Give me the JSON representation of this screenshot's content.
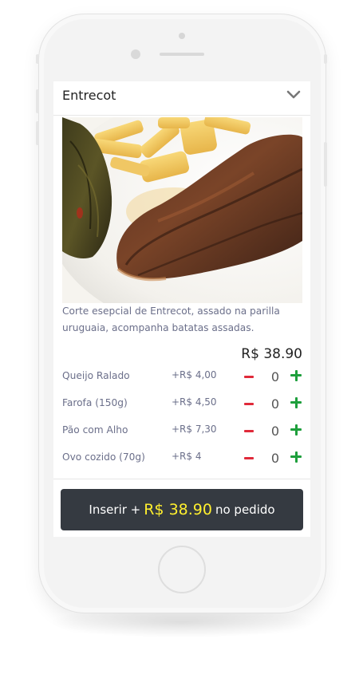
{
  "header": {
    "title": "Entrecot",
    "toggle_icon": "chevron-down-icon"
  },
  "product": {
    "image_alt": "Entrecot grelhado com batatas e pimentão assado",
    "description": "Corte esepcial de Entrecot, assado na parilla uruguaia, acompanha batatas assadas.",
    "price": "R$ 38.90"
  },
  "addons": [
    {
      "name": "Queijo Ralado",
      "price": "+R$ 4,00",
      "qty": "0"
    },
    {
      "name": "Farofa (150g)",
      "price": "+R$ 4,50",
      "qty": "0"
    },
    {
      "name": "Pão com Alho",
      "price": "+R$ 7,30",
      "qty": "0"
    },
    {
      "name": "Ovo cozido (70g)",
      "price": "+R$ 4",
      "qty": "0"
    }
  ],
  "cta": {
    "prefix": "Inserir +",
    "price": "R$ 38.90",
    "suffix": "no pedido"
  },
  "colors": {
    "minus": "#e02a3a",
    "plus": "#1e9f3c",
    "cta_bg": "#353a41",
    "cta_price": "#ffef2e"
  }
}
